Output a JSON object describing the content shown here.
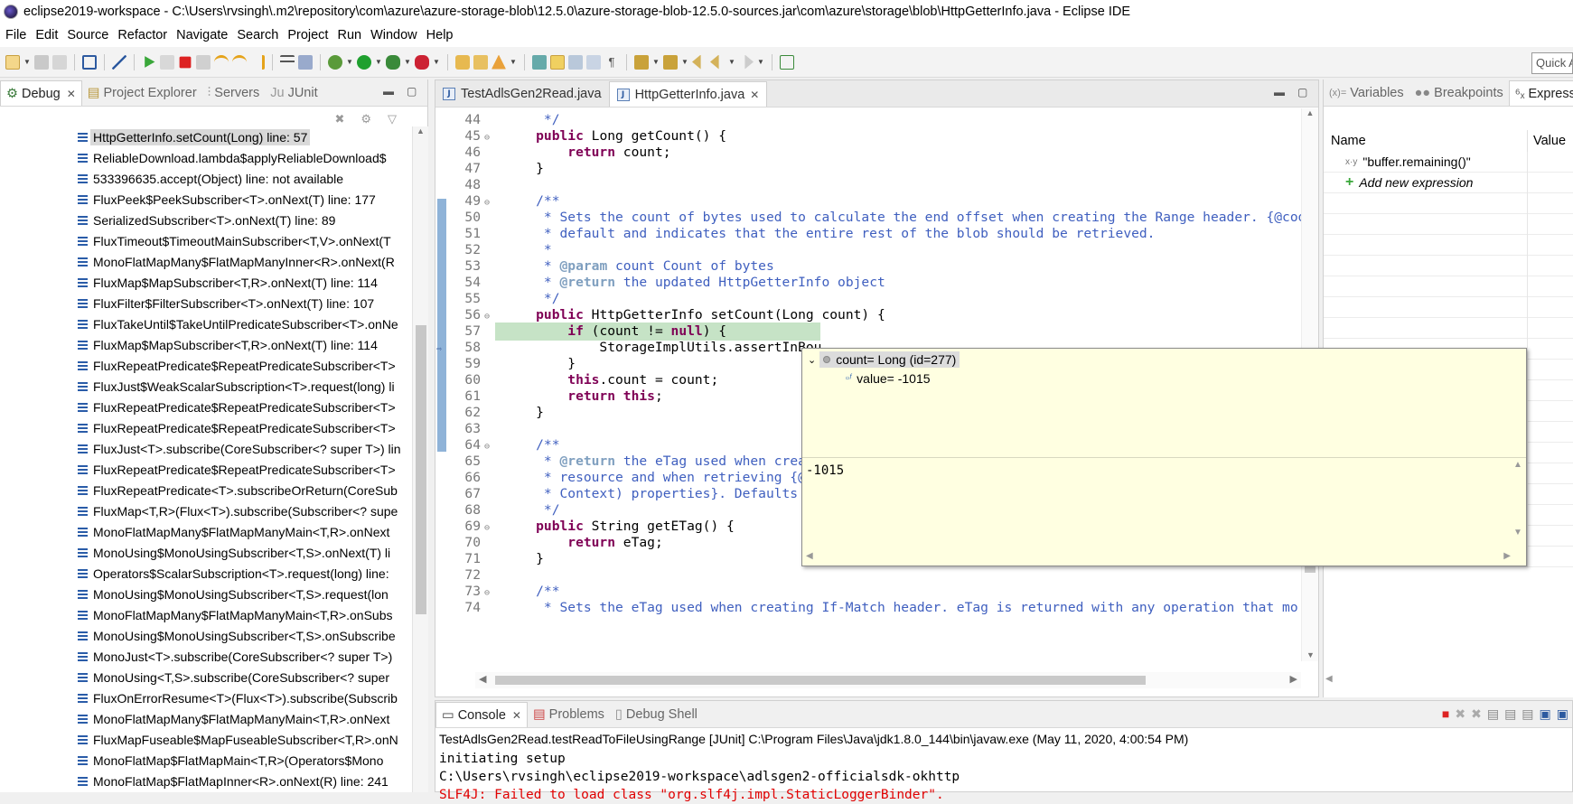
{
  "window": {
    "title": "eclipse2019-workspace - C:\\Users\\rvsingh\\.m2\\repository\\com\\azure\\azure-storage-blob\\12.5.0\\azure-storage-blob-12.5.0-sources.jar\\com\\azure\\storage\\blob\\HttpGetterInfo.java - Eclipse IDE"
  },
  "menu": [
    "File",
    "Edit",
    "Source",
    "Refactor",
    "Navigate",
    "Search",
    "Project",
    "Run",
    "Window",
    "Help"
  ],
  "quick_access": "Quick Access",
  "debug_view": {
    "tabs": [
      "Debug",
      "Project Explorer",
      "Servers",
      "JUnit"
    ],
    "frames": [
      "HttpGetterInfo.setCount(Long) line: 57",
      "ReliableDownload.lambda$applyReliableDownload$",
      "533396635.accept(Object) line: not available",
      "FluxPeek$PeekSubscriber<T>.onNext(T) line: 177",
      "SerializedSubscriber<T>.onNext(T) line: 89",
      "FluxTimeout$TimeoutMainSubscriber<T,V>.onNext(T",
      "MonoFlatMapMany$FlatMapManyInner<R>.onNext(R",
      "FluxMap$MapSubscriber<T,R>.onNext(T) line: 114",
      "FluxFilter$FilterSubscriber<T>.onNext(T) line: 107",
      "FluxTakeUntil$TakeUntilPredicateSubscriber<T>.onNe",
      "FluxMap$MapSubscriber<T,R>.onNext(T) line: 114",
      "FluxRepeatPredicate$RepeatPredicateSubscriber<T>",
      "FluxJust$WeakScalarSubscription<T>.request(long) li",
      "FluxRepeatPredicate$RepeatPredicateSubscriber<T>",
      "FluxRepeatPredicate$RepeatPredicateSubscriber<T>",
      "FluxJust<T>.subscribe(CoreSubscriber<? super T>) lin",
      "FluxRepeatPredicate$RepeatPredicateSubscriber<T>",
      "FluxRepeatPredicate<T>.subscribeOrReturn(CoreSub",
      "FluxMap<T,R>(Flux<T>).subscribe(Subscriber<? supe",
      "MonoFlatMapMany$FlatMapManyMain<T,R>.onNext",
      "MonoUsing$MonoUsingSubscriber<T,S>.onNext(T) li",
      "Operators$ScalarSubscription<T>.request(long) line:",
      "MonoUsing$MonoUsingSubscriber<T,S>.request(lon",
      "MonoFlatMapMany$FlatMapManyMain<T,R>.onSubs",
      "MonoUsing$MonoUsingSubscriber<T,S>.onSubscribe",
      "MonoJust<T>.subscribe(CoreSubscriber<? super T>)",
      "MonoUsing<T,S>.subscribe(CoreSubscriber<? super",
      "FluxOnErrorResume<T>(Flux<T>).subscribe(Subscrib",
      "MonoFlatMapMany$FlatMapManyMain<T,R>.onNext",
      "FluxMapFuseable$MapFuseableSubscriber<T,R>.onN",
      "MonoFlatMap$FlatMapMain<T,R>(Operators$Mono",
      "MonoFlatMap$FlatMapInner<R>.onNext(R) line: 241"
    ]
  },
  "editor": {
    "tabs": [
      "TestAdlsGen2Read.java",
      "HttpGetterInfo.java"
    ],
    "lines": [
      {
        "n": "44",
        "fold": "",
        "segs": [
          [
            "cm",
            "     */"
          ]
        ]
      },
      {
        "n": "45",
        "fold": "⊖",
        "segs": [
          [
            "kw",
            "    public"
          ],
          [
            "",
            " Long getCount() {"
          ]
        ]
      },
      {
        "n": "46",
        "fold": "",
        "segs": [
          [
            "kw",
            "        return"
          ],
          [
            "",
            " count;"
          ]
        ]
      },
      {
        "n": "47",
        "fold": "",
        "segs": [
          [
            "",
            "    }"
          ]
        ]
      },
      {
        "n": "48",
        "fold": "",
        "segs": [
          [
            "",
            ""
          ]
        ]
      },
      {
        "n": "49",
        "fold": "⊖",
        "segs": [
          [
            "cm",
            "    /**"
          ]
        ]
      },
      {
        "n": "50",
        "fold": "",
        "segs": [
          [
            "cm",
            "     * Sets the count of bytes used to calculate the end offset when creating the Range header. {@code"
          ]
        ]
      },
      {
        "n": "51",
        "fold": "",
        "segs": [
          [
            "cm",
            "     * default and indicates that the entire rest of the blob should be retrieved."
          ]
        ]
      },
      {
        "n": "52",
        "fold": "",
        "segs": [
          [
            "cm",
            "     *"
          ]
        ]
      },
      {
        "n": "53",
        "fold": "",
        "segs": [
          [
            "cm",
            "     * "
          ],
          [
            "tag",
            "@param"
          ],
          [
            "cm",
            " count Count of bytes"
          ]
        ]
      },
      {
        "n": "54",
        "fold": "",
        "segs": [
          [
            "cm",
            "     * "
          ],
          [
            "tag",
            "@return"
          ],
          [
            "cm",
            " the updated HttpGetterInfo object"
          ]
        ]
      },
      {
        "n": "55",
        "fold": "",
        "segs": [
          [
            "cm",
            "     */"
          ]
        ]
      },
      {
        "n": "56",
        "fold": "⊖",
        "segs": [
          [
            "kw",
            "    public"
          ],
          [
            "",
            " HttpGetterInfo setCount(Long count) {"
          ]
        ]
      },
      {
        "n": "57",
        "fold": "",
        "cur": true,
        "segs": [
          [
            "kw",
            "        if"
          ],
          [
            "",
            " (count != "
          ],
          [
            "kw",
            "null"
          ],
          [
            "",
            ") {"
          ]
        ]
      },
      {
        "n": "58",
        "fold": "",
        "segs": [
          [
            "",
            "            StorageImplUtils.assertInBou"
          ]
        ]
      },
      {
        "n": "59",
        "fold": "",
        "segs": [
          [
            "",
            "        }"
          ]
        ]
      },
      {
        "n": "60",
        "fold": "",
        "segs": [
          [
            "kw",
            "        this"
          ],
          [
            "",
            ".count = count;"
          ]
        ]
      },
      {
        "n": "61",
        "fold": "",
        "segs": [
          [
            "kw",
            "        return this"
          ],
          [
            "",
            ";"
          ]
        ]
      },
      {
        "n": "62",
        "fold": "",
        "segs": [
          [
            "",
            "    }"
          ]
        ]
      },
      {
        "n": "63",
        "fold": "",
        "segs": [
          [
            "",
            ""
          ]
        ]
      },
      {
        "n": "64",
        "fold": "⊖",
        "segs": [
          [
            "cm",
            "    /**"
          ]
        ]
      },
      {
        "n": "65",
        "fold": "",
        "segs": [
          [
            "cm",
            "     * "
          ],
          [
            "tag",
            "@return"
          ],
          [
            "cm",
            " the eTag used when creati"
          ]
        ]
      },
      {
        "n": "66",
        "fold": "",
        "segs": [
          [
            "cm",
            "     * resource and when retrieving {@li"
          ]
        ]
      },
      {
        "n": "67",
        "fold": "",
        "segs": [
          [
            "cm",
            "     * Context) properties}. Defaults to"
          ]
        ]
      },
      {
        "n": "68",
        "fold": "",
        "segs": [
          [
            "cm",
            "     */"
          ]
        ]
      },
      {
        "n": "69",
        "fold": "⊖",
        "segs": [
          [
            "kw",
            "    public"
          ],
          [
            "",
            " String getETag() {"
          ]
        ]
      },
      {
        "n": "70",
        "fold": "",
        "segs": [
          [
            "kw",
            "        return"
          ],
          [
            "",
            " eTag;"
          ]
        ]
      },
      {
        "n": "71",
        "fold": "",
        "segs": [
          [
            "",
            "    }"
          ]
        ]
      },
      {
        "n": "72",
        "fold": "",
        "segs": [
          [
            "",
            ""
          ]
        ]
      },
      {
        "n": "73",
        "fold": "⊖",
        "segs": [
          [
            "cm",
            "    /**"
          ]
        ]
      },
      {
        "n": "74",
        "fold": "",
        "segs": [
          [
            "cm",
            "     * Sets the eTag used when creating If-Match header. eTag is returned with any operation that mo"
          ]
        ]
      }
    ]
  },
  "hover": {
    "root": "count= Long  (id=277)",
    "child": "value= -1015",
    "detail": "-1015"
  },
  "expressions": {
    "tabs": [
      "Variables",
      "Breakpoints",
      "Expressions"
    ],
    "col_name": "Name",
    "col_value": "Value",
    "items": [
      "\"buffer.remaining()\""
    ],
    "add_label": "Add new expression"
  },
  "console": {
    "tabs": [
      "Console",
      "Problems",
      "Debug Shell"
    ],
    "launch": "TestAdlsGen2Read.testReadToFileUsingRange [JUnit] C:\\Program Files\\Java\\jdk1.8.0_144\\bin\\javaw.exe (May 11, 2020, 4:00:54 PM)",
    "out1": "initiating setup",
    "out2": "C:\\Users\\rvsingh\\eclipse2019-workspace\\adlsgen2-officialsdk-okhttp",
    "out3": "SLF4J: Failed to load class \"org.slf4j.impl.StaticLoggerBinder\"."
  }
}
